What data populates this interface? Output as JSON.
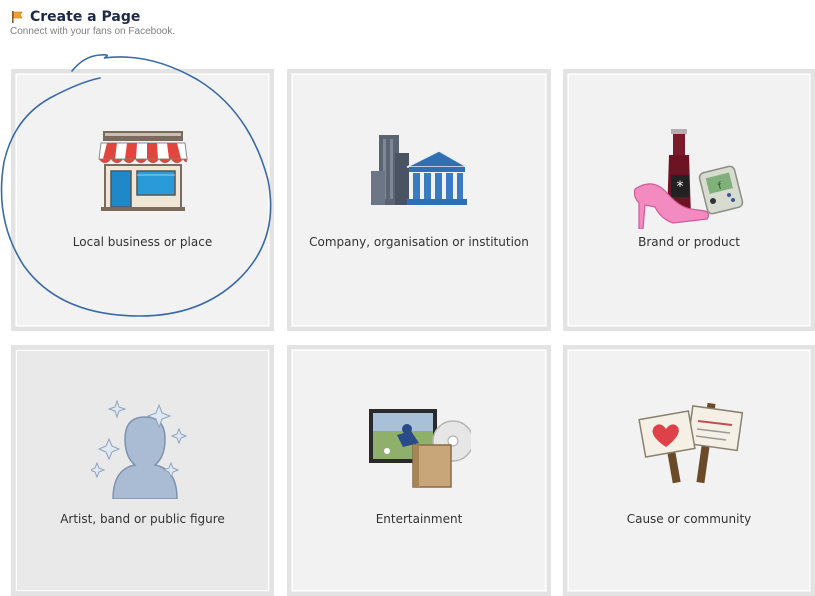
{
  "header": {
    "title": "Create a Page",
    "subtitle": "Connect with your fans on Facebook."
  },
  "categories": [
    {
      "label": "Local business or place",
      "icon": "storefront-icon"
    },
    {
      "label": "Company, organisation or institution",
      "icon": "office-building-icon"
    },
    {
      "label": "Brand or product",
      "icon": "brand-products-icon"
    },
    {
      "label": "Artist, band or public figure",
      "icon": "person-silhouette-icon"
    },
    {
      "label": "Entertainment",
      "icon": "tv-disc-book-icon"
    },
    {
      "label": "Cause or community",
      "icon": "protest-signs-icon"
    }
  ],
  "colors": {
    "tile_bg": "#f2f2f2",
    "tile_border": "#e3e3e3",
    "title": "#1c2a47",
    "annotation_stroke": "#3a6aa6"
  }
}
